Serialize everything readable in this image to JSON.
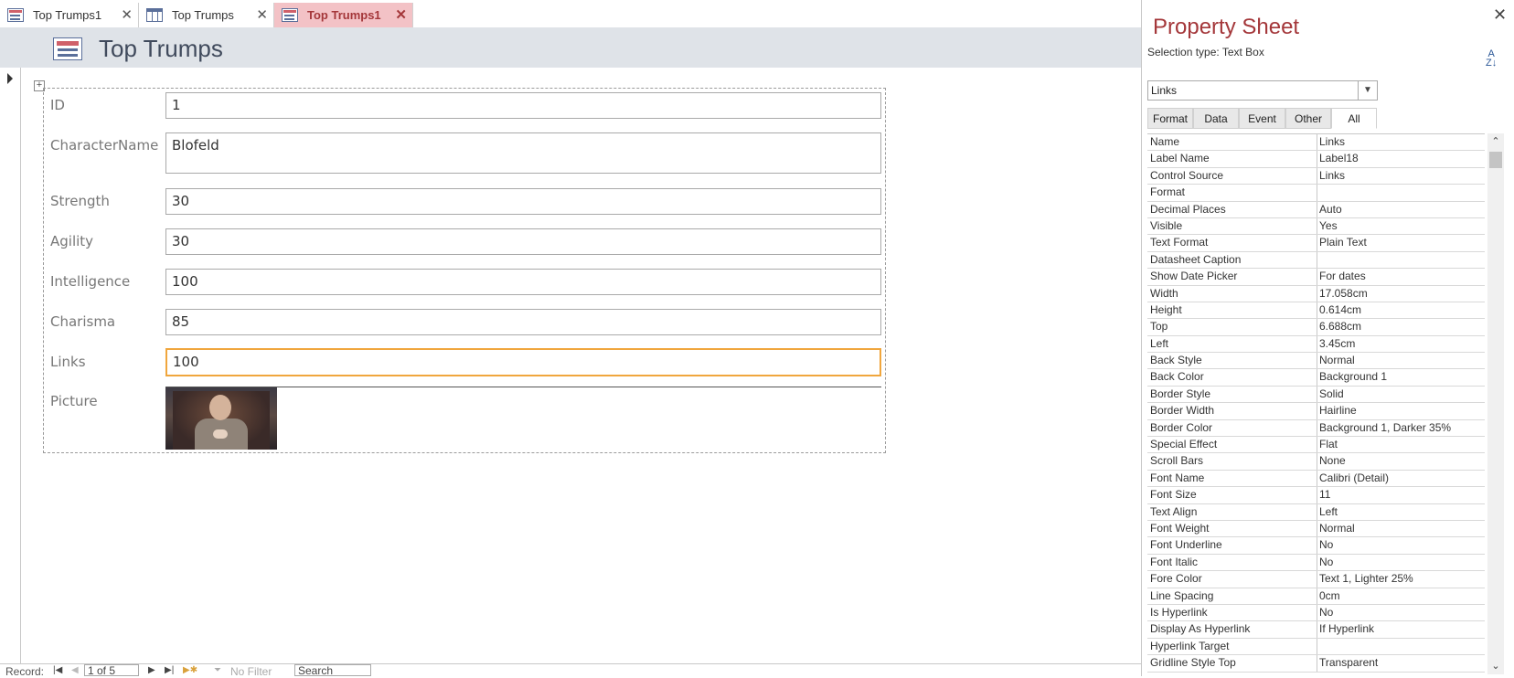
{
  "tabs": [
    {
      "label": "Top Trumps1",
      "icon": "form-icon",
      "active": false
    },
    {
      "label": "Top Trumps",
      "icon": "table-icon",
      "active": false
    },
    {
      "label": "Top Trumps1",
      "icon": "form-icon",
      "active": true
    }
  ],
  "form": {
    "title": "Top Trumps",
    "fields": [
      {
        "label": "ID",
        "value": "1"
      },
      {
        "label": "CharacterName",
        "value": "Blofeld"
      },
      {
        "label": "Strength",
        "value": "30"
      },
      {
        "label": "Agility",
        "value": "30"
      },
      {
        "label": "Intelligence",
        "value": "100"
      },
      {
        "label": "Charisma",
        "value": "85"
      },
      {
        "label": "Links",
        "value": "100",
        "selected": true
      },
      {
        "label": "Picture",
        "value": ""
      }
    ]
  },
  "nav": {
    "record_label": "Record:",
    "position": "1 of 5",
    "filter_label": "No Filter",
    "search_label": "Search"
  },
  "property_sheet": {
    "title": "Property Sheet",
    "selection_type": "Selection type:  Text Box",
    "selected_control": "Links",
    "tabs": [
      "Format",
      "Data",
      "Event",
      "Other",
      "All"
    ],
    "active_tab": "All",
    "properties": [
      [
        "Name",
        "Links"
      ],
      [
        "Label Name",
        "Label18"
      ],
      [
        "Control Source",
        "Links"
      ],
      [
        "Format",
        ""
      ],
      [
        "Decimal Places",
        "Auto"
      ],
      [
        "Visible",
        "Yes"
      ],
      [
        "Text Format",
        "Plain Text"
      ],
      [
        "Datasheet Caption",
        ""
      ],
      [
        "Show Date Picker",
        "For dates"
      ],
      [
        "Width",
        "17.058cm"
      ],
      [
        "Height",
        "0.614cm"
      ],
      [
        "Top",
        "6.688cm"
      ],
      [
        "Left",
        "3.45cm"
      ],
      [
        "Back Style",
        "Normal"
      ],
      [
        "Back Color",
        "Background 1"
      ],
      [
        "Border Style",
        "Solid"
      ],
      [
        "Border Width",
        "Hairline"
      ],
      [
        "Border Color",
        "Background 1, Darker 35%"
      ],
      [
        "Special Effect",
        "Flat"
      ],
      [
        "Scroll Bars",
        "None"
      ],
      [
        "Font Name",
        "Calibri (Detail)"
      ],
      [
        "Font Size",
        "11"
      ],
      [
        "Text Align",
        "Left"
      ],
      [
        "Font Weight",
        "Normal"
      ],
      [
        "Font Underline",
        "No"
      ],
      [
        "Font Italic",
        "No"
      ],
      [
        "Fore Color",
        "Text 1, Lighter 25%"
      ],
      [
        "Line Spacing",
        "0cm"
      ],
      [
        "Is Hyperlink",
        "No"
      ],
      [
        "Display As Hyperlink",
        "If Hyperlink"
      ],
      [
        "Hyperlink Target",
        ""
      ],
      [
        "Gridline Style Top",
        "Transparent"
      ]
    ]
  },
  "colors": {
    "accent": "#a4373a",
    "active_tab_bg": "#f3c2c6",
    "selected_border": "#f0a63d",
    "header_band": "#dfe3e8"
  }
}
